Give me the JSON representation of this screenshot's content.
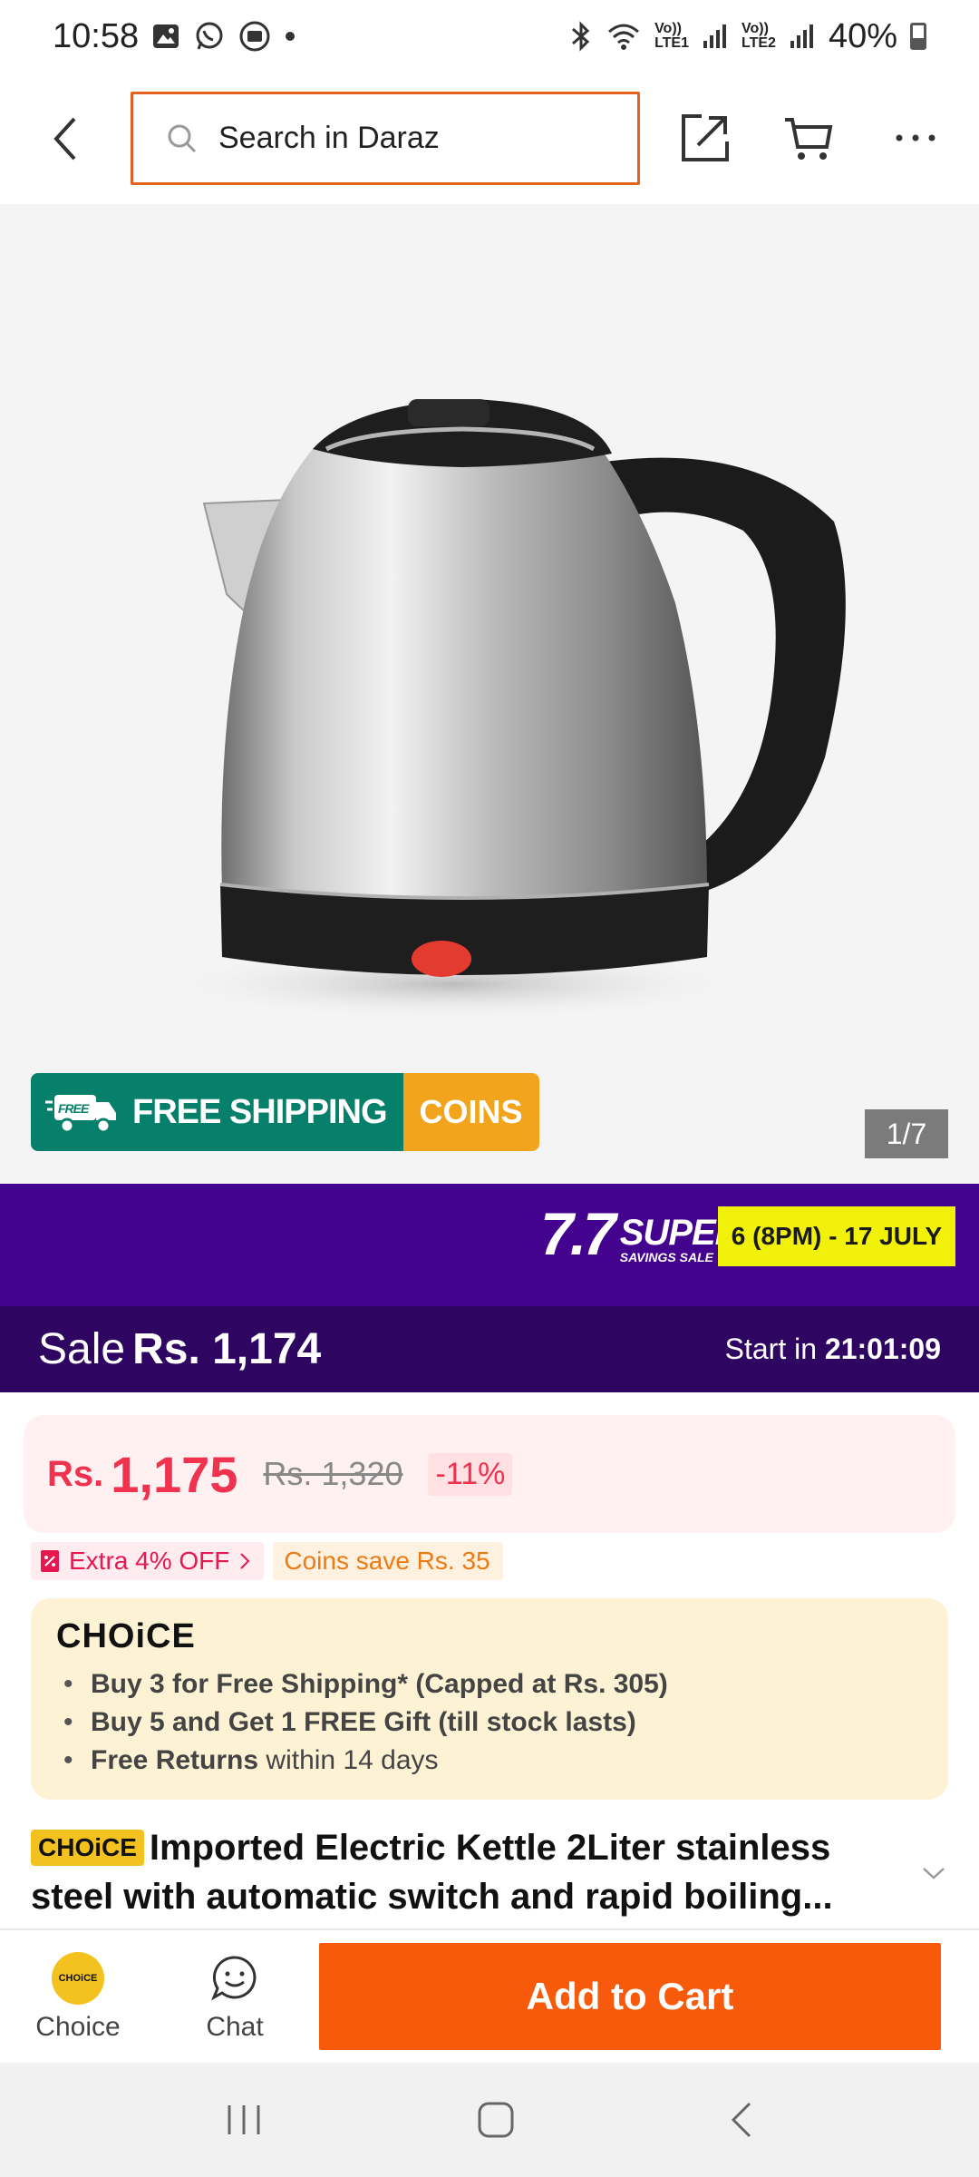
{
  "status_bar": {
    "time": "10:58",
    "lte1_top": "Vo))",
    "lte1_bottom": "LTE1",
    "lte2_top": "Vo))",
    "lte2_bottom": "LTE2",
    "battery": "40%"
  },
  "header": {
    "search_placeholder": "Search in Daraz"
  },
  "gallery": {
    "free_badge": "FREE",
    "free_shipping": "FREE SHIPPING",
    "coins": "COINS",
    "counter": "1/7"
  },
  "campaign": {
    "logo_big": "7.7",
    "logo_super": "SUPER",
    "logo_sub": "SAVINGS SALE",
    "date": "6 (8PM) - 17 JULY",
    "sale_label": "Sale",
    "sale_price": "Rs. 1,174",
    "start_label": "Start in",
    "countdown": "21:01:09"
  },
  "price": {
    "currency": "Rs.",
    "current": "1,175",
    "original": "Rs. 1,320",
    "discount": "-11%"
  },
  "promos": {
    "extra_off": "Extra 4% OFF",
    "coins_save": "Coins save Rs. 35"
  },
  "choice": {
    "logo": "CHOiCE",
    "line1": "Buy 3 for  Free Shipping* (Capped at Rs. 305)",
    "line2": "Buy 5 and Get 1 FREE Gift (till stock lasts)",
    "line3_bold": "Free Returns",
    "line3_rest": " within 14 days"
  },
  "product": {
    "badge": "CHOiCE",
    "title": "Imported Electric Kettle 2Liter stainless steel with automatic switch and rapid boiling..."
  },
  "action_bar": {
    "choice_icon_text": "CHOiCE",
    "choice_label": "Choice",
    "chat_label": "Chat",
    "add_to_cart": "Add to Cart"
  }
}
